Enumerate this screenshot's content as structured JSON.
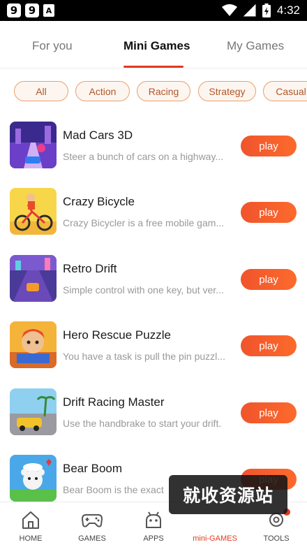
{
  "status_bar": {
    "badges": [
      "9",
      "9",
      "A"
    ],
    "time": "4:32"
  },
  "top_tabs": [
    {
      "label": "For you",
      "active": false
    },
    {
      "label": "Mini Games",
      "active": true
    },
    {
      "label": "My Games",
      "active": false
    }
  ],
  "categories": [
    {
      "label": "All",
      "selected": true
    },
    {
      "label": "Action",
      "selected": false
    },
    {
      "label": "Racing",
      "selected": false
    },
    {
      "label": "Strategy",
      "selected": false
    },
    {
      "label": "Casual",
      "selected": false
    }
  ],
  "games": [
    {
      "title": "Mad Cars 3D",
      "description": "Steer a bunch of cars on a highway...",
      "play_label": "play",
      "icon": "mad-cars-3d-icon"
    },
    {
      "title": "Crazy Bicycle",
      "description": "Crazy Bicycler is a free mobile gam...",
      "play_label": "play",
      "icon": "crazy-bicycle-icon"
    },
    {
      "title": "Retro Drift",
      "description": "Simple control with one key, but ver...",
      "play_label": "play",
      "icon": "retro-drift-icon"
    },
    {
      "title": "Hero Rescue Puzzle",
      "description": "You have a task is pull the pin puzzl...",
      "play_label": "play",
      "icon": "hero-rescue-puzzle-icon"
    },
    {
      "title": "Drift Racing Master",
      "description": "Use the handbrake to start your drift.",
      "play_label": "play",
      "icon": "drift-racing-master-icon"
    },
    {
      "title": "Bear Boom",
      "description": "Bear Boom is the exact",
      "play_label": "play",
      "icon": "bear-boom-icon"
    }
  ],
  "bottom_nav": [
    {
      "label": "HOME",
      "icon": "home-icon",
      "active": false
    },
    {
      "label": "GAMES",
      "icon": "gamepad-icon",
      "active": false
    },
    {
      "label": "APPS",
      "icon": "android-icon",
      "active": false
    },
    {
      "label": "mini-GAMES",
      "icon": "mini-games-icon",
      "active": true
    },
    {
      "label": "TOOLS",
      "icon": "tools-icon",
      "active": false
    }
  ],
  "watermark": "就收资源站",
  "colors": {
    "accent": "#e23a1e",
    "play_button": "#f45a2c",
    "chip_border": "#e8a070",
    "chip_text": "#b0562a"
  }
}
